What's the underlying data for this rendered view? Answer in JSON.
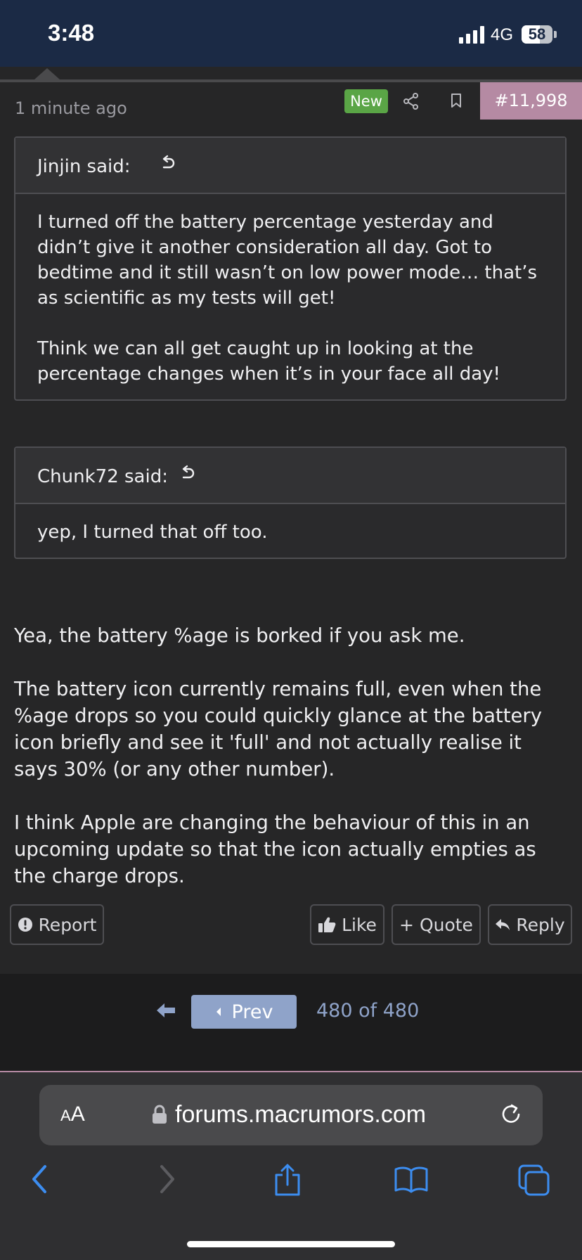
{
  "status_bar": {
    "time": "3:48",
    "network": "4G",
    "battery": "58",
    "battery_level": 0.58
  },
  "post": {
    "time_ago": "1 minute ago",
    "new_badge": "New",
    "post_number": "#11,998",
    "icons": {
      "share": "share-icon",
      "bookmark": "bookmark-icon"
    }
  },
  "quotes": [
    {
      "author": "Jinjin said:",
      "paragraphs": [
        "I turned off the battery percentage yesterday and didn’t give it another consideration all day. Got to bedtime and it still wasn’t on low power mode… that’s as scientific as my tests will get!",
        "Think we can all get caught up in looking at the percentage changes when it’s in your face all day!"
      ]
    },
    {
      "author": "Chunk72 said:",
      "paragraphs": [
        "yep, I turned that off too."
      ]
    }
  ],
  "message": {
    "paragraphs": [
      "Yea, the battery %age is borked if you ask me.",
      "The battery icon currently remains full, even when the %age drops so you could quickly glance at the battery icon briefly and see it 'full' and not actually realise it says 30% (or any other number).",
      "I think Apple are changing the behaviour of this in an upcoming update so that the icon actually empties as the charge drops."
    ]
  },
  "actions": {
    "report": "Report",
    "like": "Like",
    "quote": "+ Quote",
    "reply": "Reply"
  },
  "pagination": {
    "prev": "Prev",
    "count": "480 of 480"
  },
  "browser": {
    "text_size_label_big": "A",
    "text_size_label_small": "A",
    "url": "forums.macrumors.com",
    "toolbar": [
      "back",
      "forward",
      "share",
      "bookmarks",
      "tabs"
    ]
  },
  "colors": {
    "accent": "#8fa3c9",
    "new_badge": "#5aa546",
    "post_number_bg": "#b58aa3",
    "status_bar": "#1b2a45"
  }
}
